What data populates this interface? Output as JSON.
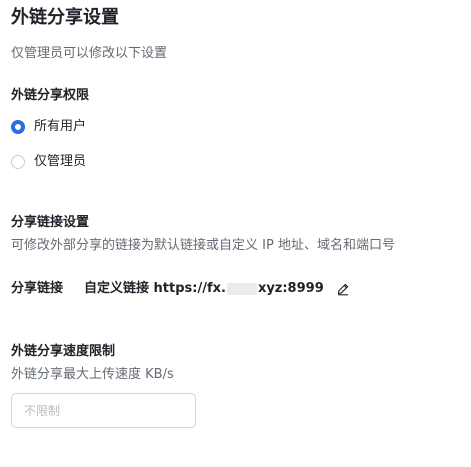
{
  "page": {
    "title": "外链分享设置",
    "subtitle": "仅管理员可以修改以下设置"
  },
  "permission": {
    "heading": "外链分享权限",
    "options": [
      {
        "label": "所有用户",
        "selected": true
      },
      {
        "label": "仅管理员",
        "selected": false
      }
    ]
  },
  "share_link_settings": {
    "heading": "分享链接设置",
    "description": "可修改外部分享的链接为默认链接或自定义 IP 地址、域名和端口号",
    "label": "分享链接",
    "value_prefix": "自定义链接 https://fx.",
    "value_suffix": "xyz:8999"
  },
  "speed_limit": {
    "heading": "外链分享速度限制",
    "description": "外链分享最大上传速度 KB/s",
    "placeholder": "不限制",
    "value": ""
  },
  "colors": {
    "accent": "#2f6bdf",
    "text_primary": "#1f2329",
    "text_secondary": "#646a73"
  }
}
